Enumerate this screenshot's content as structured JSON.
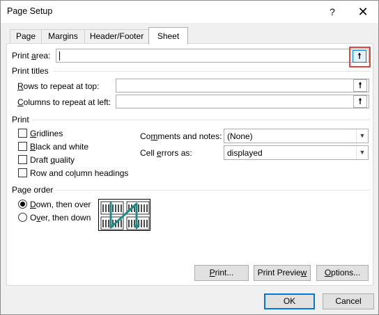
{
  "window": {
    "title": "Page Setup",
    "help_label": "?",
    "close_label": "✕"
  },
  "tabs": [
    {
      "label": "Page"
    },
    {
      "label": "Margins"
    },
    {
      "label": "Header/Footer"
    },
    {
      "label": "Sheet",
      "active": true
    }
  ],
  "print_area": {
    "label_prefix": "Print ",
    "label_accel": "a",
    "label_suffix": "rea:",
    "value": ""
  },
  "print_titles": {
    "heading": "Print titles",
    "rows": {
      "accel": "R",
      "rest": "ows to repeat at top:",
      "value": ""
    },
    "columns": {
      "accel": "C",
      "rest": "olumns to repeat at left:",
      "value": ""
    }
  },
  "print": {
    "heading": "Print",
    "gridlines": {
      "accel": "G",
      "rest": "ridlines",
      "checked": false
    },
    "black_white": {
      "accel": "B",
      "rest": "lack and white",
      "checked": false
    },
    "draft": {
      "pre": "Draft ",
      "accel": "q",
      "rest": "uality",
      "checked": false
    },
    "headings": {
      "pre": "Row and co",
      "accel": "l",
      "rest": "umn headings",
      "checked": false
    },
    "comments": {
      "pre": "Co",
      "accel": "m",
      "rest": "ments and notes:",
      "value": "(None)"
    },
    "errors": {
      "pre": "Cell ",
      "accel": "e",
      "rest": "rrors as:",
      "value": "displayed"
    }
  },
  "page_order": {
    "heading": "Page order",
    "down": {
      "accel": "D",
      "rest": "own, then over",
      "selected": true
    },
    "over": {
      "pre": "O",
      "accel": "v",
      "rest": "er, then down",
      "selected": false
    }
  },
  "buttons": {
    "print": {
      "accel": "P",
      "rest": "rint..."
    },
    "preview": {
      "pre": "Print Previe",
      "accel": "w",
      "rest": ""
    },
    "options": {
      "accel": "O",
      "rest": "ptions..."
    },
    "ok": "OK",
    "cancel": "Cancel"
  },
  "colors": {
    "accent": "#0078d7",
    "highlight_box": "#e0443e",
    "order_arrow": "#1f8a8a"
  },
  "icons": {
    "collapse": "collapse-dialog-icon",
    "dropdown": "chevron-down-icon"
  }
}
